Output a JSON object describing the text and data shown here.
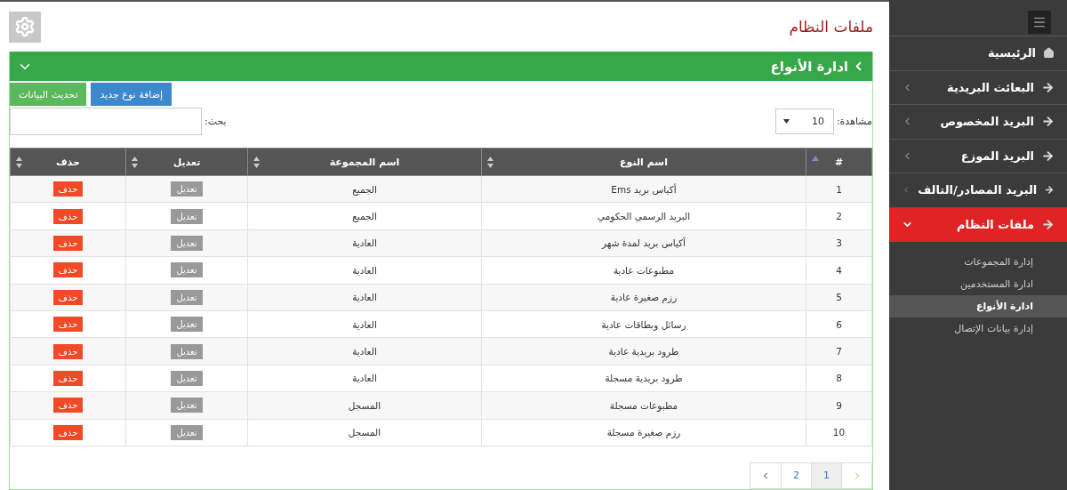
{
  "page_title": "ملفات النظام",
  "panel": {
    "title": "ادارة الأنواع",
    "expanded": true
  },
  "buttons": [
    {
      "label": "إضافة نوع جديد",
      "kind": "add"
    },
    {
      "label": "تحديث البيانات",
      "kind": "refresh"
    }
  ],
  "page_size": {
    "label": "مشاهدة:",
    "value": "10"
  },
  "search": {
    "label": "بحث:"
  },
  "table": {
    "columns": [
      {
        "label": "#",
        "sorted": true
      },
      {
        "label": "اسم النوع",
        "sorted": false
      },
      {
        "label": "اسم المجموعة",
        "sorted": false
      },
      {
        "label": "تعديل",
        "sorted": false
      },
      {
        "label": "حذف",
        "sorted": false
      }
    ],
    "rows": [
      {
        "number": "1",
        "name": "أكياس بريد Ems",
        "group": "الجميع",
        "edit": "تعديل",
        "delete": "حذف"
      },
      {
        "number": "2",
        "name": "البريد الرسمي الحكومي",
        "group": "الجميع",
        "edit": "تعديل",
        "delete": "حذف"
      },
      {
        "number": "3",
        "name": "أكياس بريد لمدة شهر",
        "group": "العادية",
        "edit": "تعديل",
        "delete": "حذف"
      },
      {
        "number": "4",
        "name": "مطبوعات عادية",
        "group": "العادية",
        "edit": "تعديل",
        "delete": "حذف"
      },
      {
        "number": "5",
        "name": "رزم صغيرة عادية",
        "group": "العادية",
        "edit": "تعديل",
        "delete": "حذف"
      },
      {
        "number": "6",
        "name": "رسائل وبطاقات عادية",
        "group": "العادية",
        "edit": "تعديل",
        "delete": "حذف"
      },
      {
        "number": "7",
        "name": "طرود بريدية عادية",
        "group": "العادية",
        "edit": "تعديل",
        "delete": "حذف"
      },
      {
        "number": "8",
        "name": "طرود بريدية مسجلة",
        "group": "العادية",
        "edit": "تعديل",
        "delete": "حذف"
      },
      {
        "number": "9",
        "name": "مطبوعات مسجلة",
        "group": "المسجل",
        "edit": "تعديل",
        "delete": "حذف"
      },
      {
        "number": "10",
        "name": "رزم صغيرة مسجلة",
        "group": "المسجل",
        "edit": "تعديل",
        "delete": "حذف"
      }
    ]
  },
  "pagination": [
    {
      "kind": "prev"
    },
    {
      "kind": "page",
      "label": "1",
      "selected": true
    },
    {
      "kind": "page",
      "label": "2",
      "selected": false
    },
    {
      "kind": "next"
    }
  ],
  "sidebar": {
    "items": [
      {
        "label": "الرئيسية",
        "kind": "home",
        "expandable": false,
        "selected": false
      },
      {
        "label": "البعائث البريدية",
        "kind": "arrow",
        "expandable": true,
        "selected": false
      },
      {
        "label": "البريد المخصوص",
        "kind": "arrow",
        "expandable": true,
        "selected": false
      },
      {
        "label": "البريد الموزع",
        "kind": "arrow",
        "expandable": true,
        "selected": false
      },
      {
        "label": "البريد المصادر/التالف",
        "kind": "arrow",
        "expandable": true,
        "selected": false
      },
      {
        "label": "ملفات النظام",
        "kind": "arrow",
        "expandable": true,
        "selected": true,
        "children": [
          {
            "label": "إدارة المجموعات",
            "selected": false
          },
          {
            "label": "ادارة المستخدمين",
            "selected": false
          },
          {
            "label": "ادارة الأنواع",
            "selected": true
          },
          {
            "label": "إدارة بيانات الإتصال",
            "selected": false
          }
        ]
      }
    ]
  }
}
